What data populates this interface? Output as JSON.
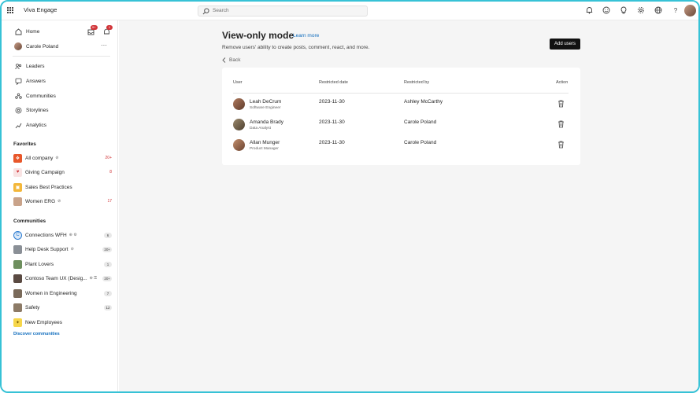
{
  "app": {
    "title": "Viva Engage"
  },
  "search": {
    "placeholder": "Search"
  },
  "topbar": {
    "icons": [
      "bell-icon",
      "emoji-icon",
      "lightbulb-icon",
      "gear-icon",
      "globe-icon",
      "help-icon"
    ]
  },
  "sidebar": {
    "home_label": "Home",
    "inbox_badge": "9+",
    "notif_badge": "1",
    "profile_name": "Carole Poland",
    "nav": [
      {
        "label": "Leaders",
        "icon": "leaders-icon"
      },
      {
        "label": "Answers",
        "icon": "answers-icon"
      },
      {
        "label": "Communities",
        "icon": "communities-icon"
      },
      {
        "label": "Storylines",
        "icon": "storylines-icon"
      },
      {
        "label": "Analytics",
        "icon": "analytics-icon"
      }
    ],
    "favorites_title": "Favorites",
    "favorites": [
      {
        "label": "All company",
        "count": "20+",
        "color": "#e8572a"
      },
      {
        "label": "Giving Campaign",
        "count": "8",
        "color": "#f9e3e3"
      },
      {
        "label": "Sales Best Practices",
        "count": "",
        "color": "#f3b73a"
      },
      {
        "label": "Women ERG",
        "count": "17",
        "color": "#c9a38a"
      }
    ],
    "communities_title": "Communities",
    "communities": [
      {
        "label": "Connections WFH",
        "count": "6",
        "color": "#2b7bd1"
      },
      {
        "label": "Help Desk Support",
        "count": "20+",
        "color": "#8a8f96"
      },
      {
        "label": "Plant Lovers",
        "count": "1",
        "color": "#6e8f5e"
      },
      {
        "label": "Contoso Team UX (Desig...",
        "count": "20+",
        "color": "#5a4a42"
      },
      {
        "label": "Women in Engineering",
        "count": "7",
        "color": "#7a6a5a"
      },
      {
        "label": "Safety",
        "count": "12",
        "color": "#8c7a66"
      },
      {
        "label": "New Employees",
        "count": "",
        "color": "#f6d64a"
      }
    ],
    "discover_label": "Discover communities"
  },
  "main": {
    "title": "View-only mode",
    "learn_more": "Learn more",
    "subtitle": "Remove users' ability to create posts, comment, react, and more.",
    "add_users": "Add users",
    "back": "Back",
    "table": {
      "headers": {
        "user": "User",
        "date": "Restricted date",
        "by": "Restricted by",
        "action": "Action"
      },
      "rows": [
        {
          "name": "Leah DeCrum",
          "role": "Software Engineer",
          "date": "2023-11-30",
          "by": "Ashley McCarthy"
        },
        {
          "name": "Amanda Brady",
          "role": "Data Analyst",
          "date": "2023-11-30",
          "by": "Carole Poland"
        },
        {
          "name": "Allan Munger",
          "role": "Product Manager",
          "date": "2023-11-30",
          "by": "Carole Poland"
        }
      ]
    }
  }
}
